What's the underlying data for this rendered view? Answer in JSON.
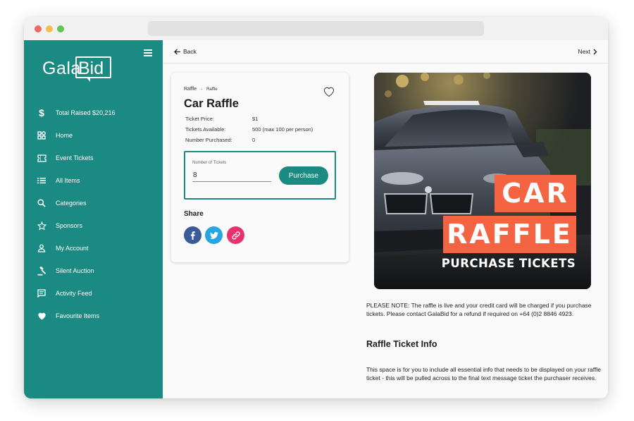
{
  "brand": {
    "logo_primary": "Gala",
    "logo_secondary": "Bid",
    "accent_color": "#1a8a82",
    "sidebar_color": "#1a8a82",
    "poster_orange": "#f46342"
  },
  "sidebar": {
    "items": [
      {
        "label": "Total Raised $20,216",
        "icon": "dollar-icon"
      },
      {
        "label": "Home",
        "icon": "dashboard-icon"
      },
      {
        "label": "Event Tickets",
        "icon": "ticket-icon"
      },
      {
        "label": "All Items",
        "icon": "list-icon"
      },
      {
        "label": "Categories",
        "icon": "search-icon"
      },
      {
        "label": "Sponsors",
        "icon": "star-icon"
      },
      {
        "label": "My Account",
        "icon": "user-icon"
      },
      {
        "label": "Silent Auction",
        "icon": "gavel-icon"
      },
      {
        "label": "Activity Feed",
        "icon": "feed-icon"
      },
      {
        "label": "Favourite Items",
        "icon": "heart-icon"
      }
    ]
  },
  "topbar": {
    "back_label": "Back",
    "next_label": "Next"
  },
  "item": {
    "breadcrumb_parent": "Raffle",
    "breadcrumb_separator": "-",
    "breadcrumb_current": "Raffle",
    "title": "Car Raffle",
    "details": [
      {
        "label": "Ticket Price:",
        "value": "$1"
      },
      {
        "label": "Tickets Available:",
        "value": "500 (max 100 per person)"
      },
      {
        "label": "Number Purchased:",
        "value": "0"
      }
    ],
    "ticket_field_label": "Number of Tickets",
    "ticket_field_value": "8",
    "purchase_label": "Purchase",
    "share_title": "Share"
  },
  "poster": {
    "line1": "CAR",
    "line2": "RAFFLE",
    "line3": "PURCHASE TICKETS"
  },
  "content": {
    "note": "PLEASE NOTE: The raffle is live and your credit card will be charged if you purchase tickets. Please contact GalaBid for a refund if required on +64 (0)2 8846 4923.",
    "info_title": "Raffle Ticket Info",
    "info_description": "This space is for you to include all essential info that needs to be displayed on your raffle ticket - this will be pulled across to the final text message ticket the purchaser receives."
  }
}
